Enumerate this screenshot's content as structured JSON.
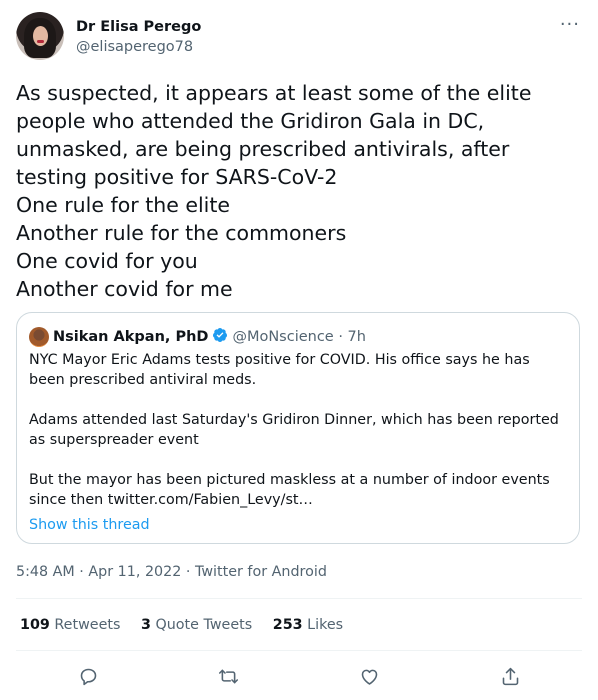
{
  "author": {
    "display_name": "Dr Elisa Perego",
    "handle": "@elisaperego78"
  },
  "tweet": {
    "text": "As suspected, it appears at least some of the elite people who attended the Gridiron Gala in DC, unmasked, are being prescribed antivirals, after testing positive for SARS-CoV-2\nOne rule for the elite\nAnother rule for the commoners\nOne covid for you\nAnother covid for me"
  },
  "quote": {
    "display_name": "Nsikan Akpan, PhD",
    "handle_time": "@MoNscience · 7h",
    "body": "NYC Mayor Eric Adams tests positive for COVID. His office says he has been prescribed antiviral meds.\n\nAdams attended last Saturday's Gridiron Dinner, which has been reported as superspreader event\n\nBut the mayor has been pictured maskless at a number of indoor events since then twitter.com/Fabien_Levy/st…",
    "show_thread": "Show this thread"
  },
  "meta": {
    "timestamp": "5:48 AM · Apr 11, 2022 · Twitter for Android"
  },
  "stats": {
    "retweets_count": "109",
    "retweets_label": "Retweets",
    "quotes_count": "3",
    "quotes_label": "Quote Tweets",
    "likes_count": "253",
    "likes_label": "Likes"
  },
  "colors": {
    "accent": "#1d9bf0",
    "secondary_text": "#536471",
    "border": "#cfd9de"
  },
  "icons": {
    "more": "more-icon",
    "reply": "reply-icon",
    "retweet": "retweet-icon",
    "like": "like-icon",
    "share": "share-icon",
    "verified": "verified-badge-icon"
  }
}
